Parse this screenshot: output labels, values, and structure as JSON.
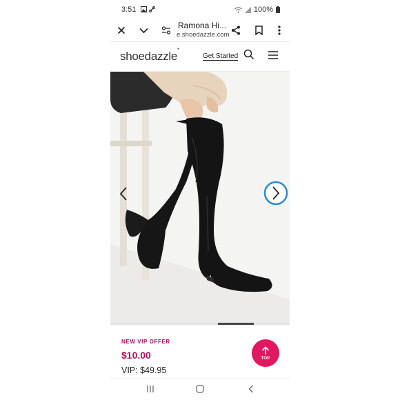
{
  "status": {
    "time": "3:51",
    "battery": "100%"
  },
  "browser": {
    "page_title": "Ramona Hi...",
    "domain": "e.shoedazzle.com"
  },
  "site": {
    "logo": "shoedazzle",
    "logo_mark": "*",
    "get_started": "Get Started"
  },
  "carousel": {
    "progress_fraction": 0.2,
    "progress_position": 0.6
  },
  "product": {
    "offer_label": "NEW VIP OFFER",
    "price": "$10.00",
    "vip_price": "VIP: $49.95"
  },
  "scroll_top": {
    "label": "TOP"
  },
  "colors": {
    "accent": "#b0115f",
    "top_button": "#e0185f",
    "highlight_ring": "#2a8bd0"
  },
  "icons": [
    "close-icon",
    "chevron-down-icon",
    "page-settings-icon",
    "share-icon",
    "bookmark-icon",
    "more-vert-icon",
    "search-icon",
    "hamburger-menu-icon",
    "chevron-left-icon",
    "chevron-right-icon",
    "arrow-up-icon"
  ]
}
